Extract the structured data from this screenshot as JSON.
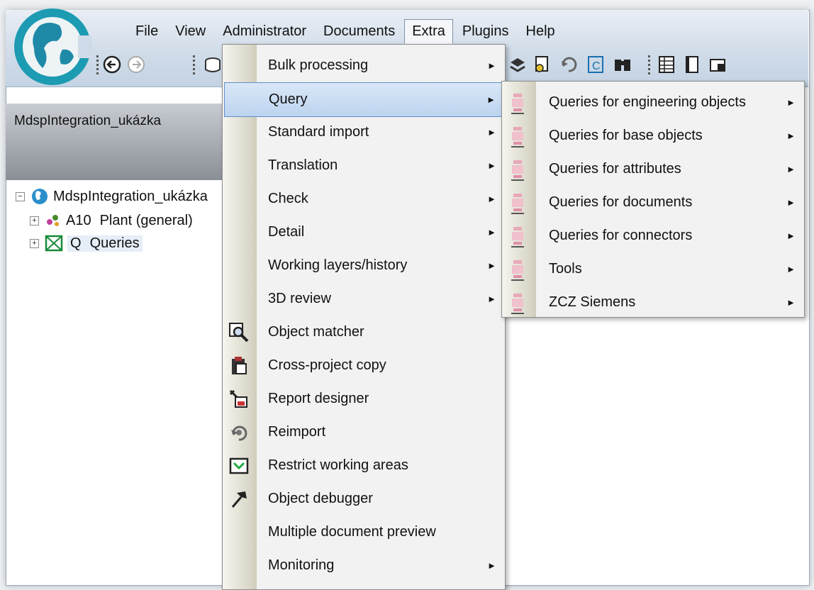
{
  "menubar": [
    "File",
    "View",
    "Administrator",
    "Documents",
    "Extra",
    "Plugins",
    "Help"
  ],
  "active_menu": "Extra",
  "left_panel": {
    "title": "MdspIntegration_ukázka",
    "tree": {
      "root": "MdspIntegration_ukázka",
      "child1_code": "A10",
      "child1_label": "Plant (general)",
      "child2_code": "Q",
      "child2_label": "Queries"
    }
  },
  "extra_menu": {
    "items": [
      {
        "label": "Bulk processing",
        "submenu": true
      },
      {
        "label": "Query",
        "submenu": true,
        "selected": true
      },
      {
        "label": "Standard import",
        "submenu": true
      },
      {
        "label": "Translation",
        "submenu": true
      },
      {
        "label": "Check",
        "submenu": true
      },
      {
        "label": "Detail",
        "submenu": true
      },
      {
        "label": "Working layers/history",
        "submenu": true
      },
      {
        "label": "3D review",
        "submenu": true
      },
      {
        "label": "Object matcher",
        "icon": "magnifier-icon"
      },
      {
        "label": "Cross-project copy",
        "icon": "clipboard-icon"
      },
      {
        "label": "Report designer",
        "icon": "report-designer-icon"
      },
      {
        "label": "Reimport",
        "icon": "reimport-icon"
      },
      {
        "label": "Restrict working areas",
        "icon": "restrict-areas-icon"
      },
      {
        "label": "Object debugger",
        "icon": "hammer-icon"
      },
      {
        "label": "Multiple document preview"
      },
      {
        "label": "Monitoring",
        "submenu": true
      }
    ]
  },
  "query_submenu": {
    "items": [
      {
        "label": "Queries for engineering objects",
        "submenu": true
      },
      {
        "label": "Queries for base objects",
        "submenu": true
      },
      {
        "label": "Queries for attributes",
        "submenu": true
      },
      {
        "label": "Queries for documents",
        "submenu": true
      },
      {
        "label": "Queries for connectors",
        "submenu": true
      },
      {
        "label": "Tools",
        "submenu": true
      },
      {
        "label": "ZCZ Siemens",
        "submenu": true
      }
    ]
  },
  "arrow_glyph": "►",
  "colors": {
    "accent": "#5e8fc8",
    "highlight": "#bcd4ef",
    "logo": "#1d9bb3"
  }
}
